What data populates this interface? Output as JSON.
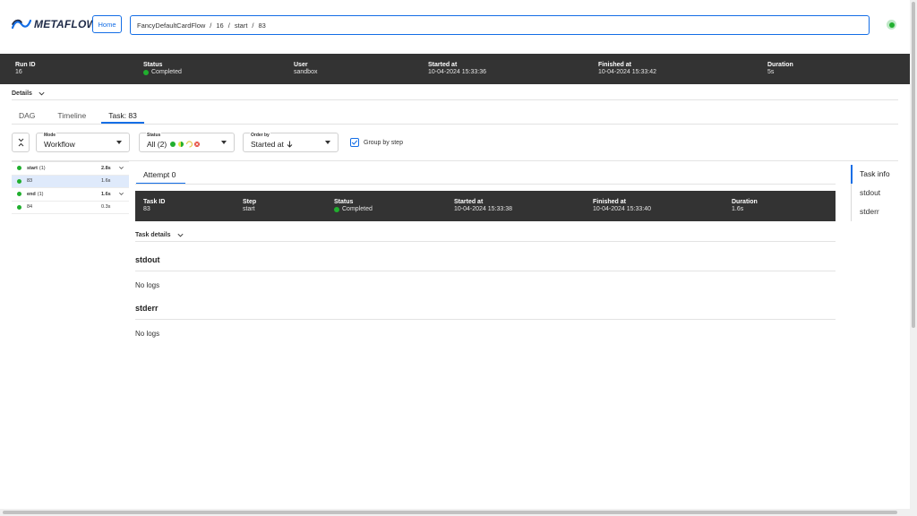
{
  "header": {
    "logo_text": "METAFLOW",
    "home_label": "Home",
    "breadcrumb": [
      "FancyDefaultCardFlow",
      "16",
      "start",
      "83"
    ],
    "breadcrumb_sep": "/"
  },
  "run": {
    "run_id_label": "Run ID",
    "run_id": "16",
    "status_label": "Status",
    "status": "Completed",
    "user_label": "User",
    "user": "sandbox",
    "started_label": "Started at",
    "started": "10-04-2024 15:33:36",
    "finished_label": "Finished at",
    "finished": "10-04-2024 15:33:42",
    "duration_label": "Duration",
    "duration": "5s"
  },
  "details_label": "Details",
  "tabs": [
    {
      "label": "DAG",
      "active": false
    },
    {
      "label": "Timeline",
      "active": false
    },
    {
      "label": "Task: 83",
      "active": true
    }
  ],
  "filters": {
    "mode_label": "Mode",
    "mode_value": "Workflow",
    "status_label": "Status",
    "status_value": "All (2)",
    "order_label": "Order by",
    "order_value": "Started at",
    "group_label": "Group by step",
    "group_checked": true
  },
  "task_list": [
    {
      "name": "start",
      "count": "(1)",
      "time": "2.8s",
      "type": "step"
    },
    {
      "name": "83",
      "time": "1.6s",
      "type": "task",
      "selected": true
    },
    {
      "name": "end",
      "count": "(1)",
      "time": "1.6s",
      "type": "step"
    },
    {
      "name": "84",
      "time": "0.3s",
      "type": "task"
    }
  ],
  "attempt_label": "Attempt 0",
  "task": {
    "id_label": "Task ID",
    "id": "83",
    "step_label": "Step",
    "step": "start",
    "status_label": "Status",
    "status": "Completed",
    "started_label": "Started at",
    "started": "10-04-2024 15:33:38",
    "finished_label": "Finished at",
    "finished": "10-04-2024 15:33:40",
    "duration_label": "Duration",
    "duration": "1.6s"
  },
  "task_details_label": "Task details",
  "stdout_title": "stdout",
  "stdout_empty": "No logs",
  "stderr_title": "stderr",
  "stderr_empty": "No logs",
  "right_nav": [
    {
      "label": "Task info",
      "active": true
    },
    {
      "label": "stdout",
      "active": false
    },
    {
      "label": "stderr",
      "active": false
    }
  ],
  "colors": {
    "accent": "#146ee6",
    "success": "#20af2e",
    "dark_bar": "#333333"
  }
}
